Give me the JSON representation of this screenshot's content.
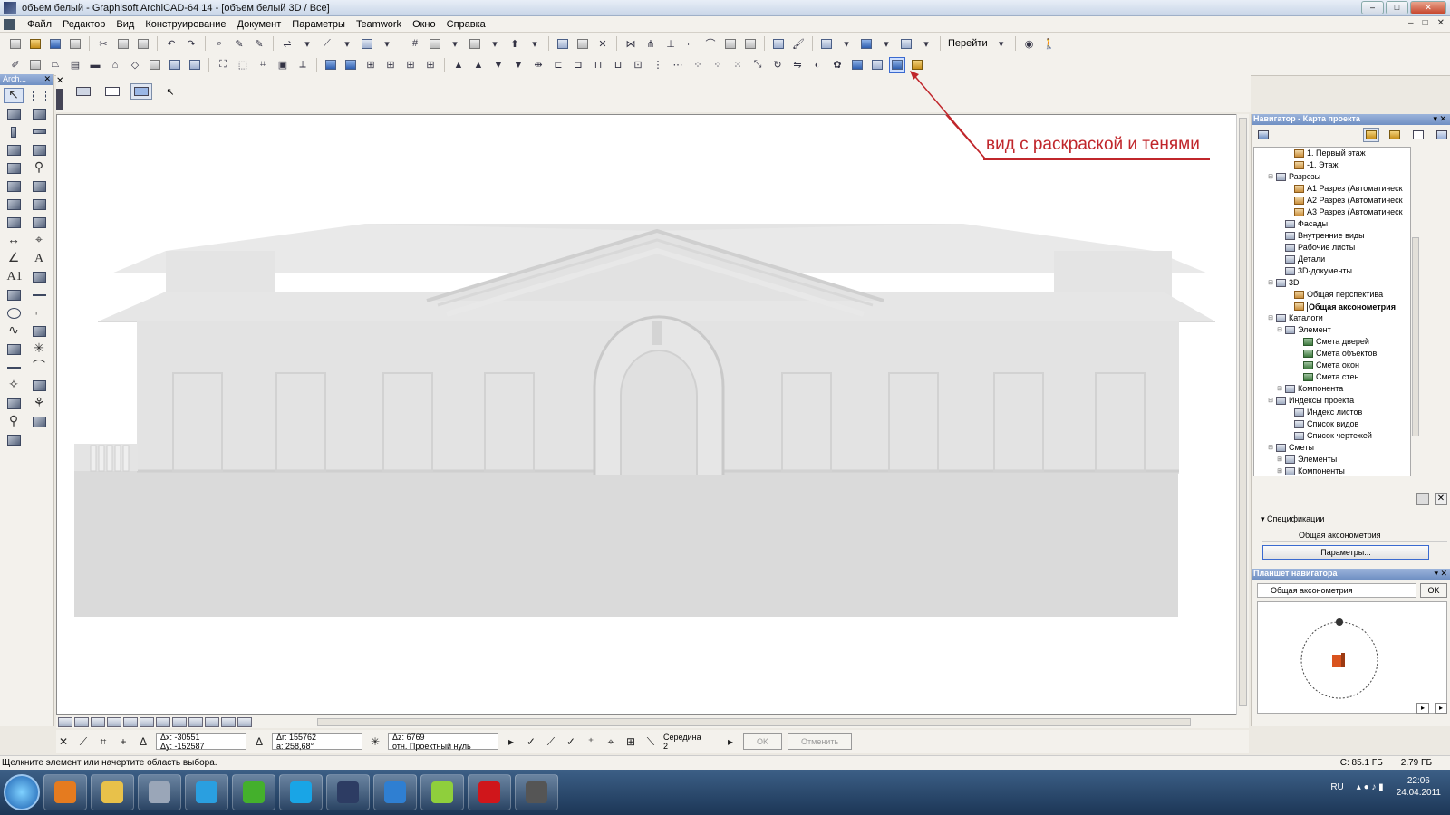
{
  "window": {
    "title": "объем белый - Graphisoft ArchiCAD-64 14 - [объем белый 3D / Все]",
    "minimize": "–",
    "maximize": "□",
    "close": "✕"
  },
  "menubar": {
    "items": [
      "Файл",
      "Редактор",
      "Вид",
      "Конструирование",
      "Документ",
      "Параметры",
      "Teamwork",
      "Окно",
      "Справка"
    ]
  },
  "toolbar": {
    "goto_label": "Перейти"
  },
  "toolbox": {
    "title": "Arch...",
    "close": "✕"
  },
  "annotation": {
    "text": "вид с раскраской и тенями",
    "color": "#c0262b"
  },
  "controlbar": {
    "dx": "Δx: -30551",
    "dy": "Δy: -152587",
    "dr": "Δr: 155762",
    "angle": "a: 258,68°",
    "dz": "Δz: 6769",
    "ref": "отн. Проектный нуль",
    "snap_label": "Середина",
    "snap_value": "2",
    "ok": "OK",
    "cancel": "Отменить"
  },
  "status": {
    "hint": "Щелкните элемент или начертите область выбора.",
    "disk": "С: 85.1 ГБ",
    "memory": "2.79 ГБ"
  },
  "navigator": {
    "title": "Навигатор - Карта проекта",
    "tree": [
      {
        "label": "1. Первый этаж",
        "indent": 3,
        "icon": "house",
        "toggle": ""
      },
      {
        "label": "-1. Этаж",
        "indent": 3,
        "icon": "house",
        "toggle": ""
      },
      {
        "label": "Разрезы",
        "indent": 1,
        "icon": "folder",
        "toggle": "⊟"
      },
      {
        "label": "A1 Разрез (Автоматическ",
        "indent": 3,
        "icon": "house",
        "toggle": ""
      },
      {
        "label": "A2 Разрез (Автоматическ",
        "indent": 3,
        "icon": "house",
        "toggle": ""
      },
      {
        "label": "A3 Разрез (Автоматическ",
        "indent": 3,
        "icon": "house",
        "toggle": ""
      },
      {
        "label": "Фасады",
        "indent": 2,
        "icon": "folder",
        "toggle": ""
      },
      {
        "label": "Внутренние виды",
        "indent": 2,
        "icon": "folder",
        "toggle": ""
      },
      {
        "label": "Рабочие листы",
        "indent": 2,
        "icon": "folder",
        "toggle": ""
      },
      {
        "label": "Детали",
        "indent": 2,
        "icon": "folder",
        "toggle": ""
      },
      {
        "label": "3D-документы",
        "indent": 2,
        "icon": "folder",
        "toggle": ""
      },
      {
        "label": "3D",
        "indent": 1,
        "icon": "folder",
        "toggle": "⊟"
      },
      {
        "label": "Общая перспектива",
        "indent": 3,
        "icon": "house",
        "toggle": ""
      },
      {
        "label": "Общая аксонометрия",
        "indent": 3,
        "icon": "house",
        "toggle": "",
        "selected": true
      },
      {
        "label": "Каталоги",
        "indent": 1,
        "icon": "folder",
        "toggle": "⊟"
      },
      {
        "label": "Элемент",
        "indent": 2,
        "icon": "folder",
        "toggle": "⊟"
      },
      {
        "label": "Смета дверей",
        "indent": 4,
        "icon": "sheet",
        "toggle": ""
      },
      {
        "label": "Смета объектов",
        "indent": 4,
        "icon": "sheet",
        "toggle": ""
      },
      {
        "label": "Смета окон",
        "indent": 4,
        "icon": "sheet",
        "toggle": ""
      },
      {
        "label": "Смета стен",
        "indent": 4,
        "icon": "sheet",
        "toggle": ""
      },
      {
        "label": "Компонента",
        "indent": 2,
        "icon": "folder",
        "toggle": "⊞"
      },
      {
        "label": "Индексы проекта",
        "indent": 1,
        "icon": "folder",
        "toggle": "⊟"
      },
      {
        "label": "Индекс листов",
        "indent": 3,
        "icon": "folder",
        "toggle": ""
      },
      {
        "label": "Список видов",
        "indent": 3,
        "icon": "folder",
        "toggle": ""
      },
      {
        "label": "Список чертежей",
        "indent": 3,
        "icon": "folder",
        "toggle": ""
      },
      {
        "label": "Сметы",
        "indent": 1,
        "icon": "folder",
        "toggle": "⊟"
      },
      {
        "label": "Элементы",
        "indent": 2,
        "icon": "folder",
        "toggle": "⊞"
      },
      {
        "label": "Компоненты",
        "indent": 2,
        "icon": "folder",
        "toggle": "⊞"
      }
    ]
  },
  "specs": {
    "title": "Спецификации",
    "name": "Общая аксонометрия",
    "params_button": "Параметры..."
  },
  "navtablet": {
    "title": "Планшет навигатора",
    "view": "Общая аксонометрия",
    "ok": "OK"
  },
  "taskbar": {
    "lang": "RU",
    "time": "22:06",
    "date": "24.04.2011",
    "apps": [
      {
        "name": "media-player",
        "color": "#e57b1f"
      },
      {
        "name": "explorer",
        "color": "#e8c14a"
      },
      {
        "name": "calculator",
        "color": "#9aa6b8"
      },
      {
        "name": "xmarks",
        "color": "#2a9fe0"
      },
      {
        "name": "icq",
        "color": "#44b02c"
      },
      {
        "name": "skype",
        "color": "#19a5e6"
      },
      {
        "name": "archicad",
        "color": "#2d3c63"
      },
      {
        "name": "internet-explorer",
        "color": "#2f7fd2"
      },
      {
        "name": "archicad-file",
        "color": "#8fcf3c"
      },
      {
        "name": "opera",
        "color": "#d0161b"
      },
      {
        "name": "camera",
        "color": "#555555"
      }
    ]
  }
}
